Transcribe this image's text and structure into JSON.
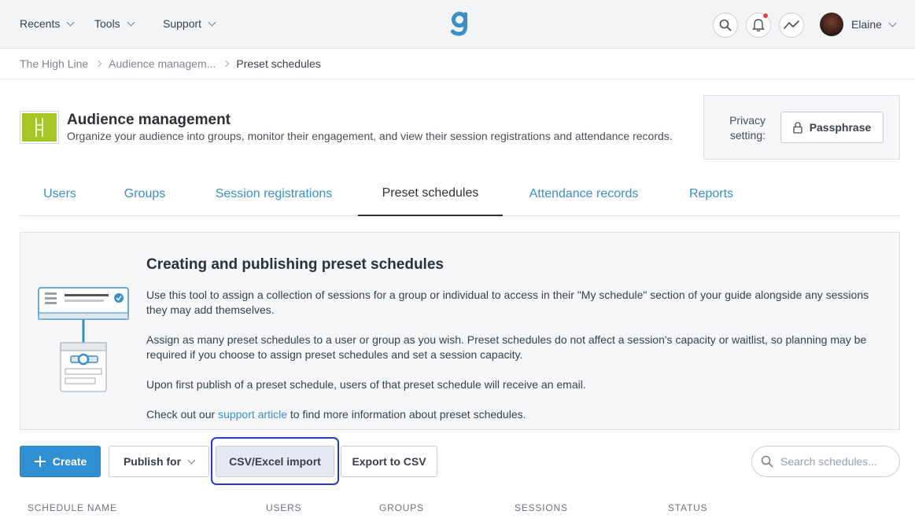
{
  "nav": {
    "menus": [
      {
        "label": "Recents"
      },
      {
        "label": "Tools"
      },
      {
        "label": "Support"
      }
    ],
    "user_name": "Elaine",
    "colors": {
      "logo": "#3a8fc4",
      "notification_dot": "#e3424b"
    }
  },
  "breadcrumb": [
    "The High Line",
    "Audience managem...",
    "Preset schedules"
  ],
  "header": {
    "title": "Audience management",
    "description": "Organize your audience into groups, monitor their engagement,  and view their session registrations and attendance records.",
    "privacy_label_line1": "Privacy",
    "privacy_label_line2": "setting:",
    "passphrase_label": "Passphrase",
    "icon_color": "#a8c526"
  },
  "tabs": [
    {
      "label": "Users"
    },
    {
      "label": "Groups"
    },
    {
      "label": "Session registrations"
    },
    {
      "label": "Preset schedules",
      "active": true
    },
    {
      "label": "Attendance records"
    },
    {
      "label": "Reports"
    }
  ],
  "info": {
    "title": "Creating and publishing preset schedules",
    "p1": "Use this tool to assign a collection of sessions for a group or individual to access in their \"My schedule\" section of your guide alongside any sessions they may add themselves.",
    "p2": "Assign as many preset schedules to a user or group as you wish. Preset schedules do not affect a session's capacity or waitlist, so planning may be required if you choose to assign preset schedules and set a session capacity.",
    "p3": "Upon first publish of a preset schedule, users of that preset schedule will receive an email.",
    "p4_before": "Check out our ",
    "p4_link": "support article",
    "p4_after": " to find more information about preset schedules."
  },
  "toolbar": {
    "create_label": "Create",
    "publish_label": "Publish for",
    "import_label": "CSV/Excel import",
    "export_label": "Export to CSV",
    "search_placeholder": "Search schedules...",
    "accent": "#2f8fd1",
    "highlight": "#2540c4"
  },
  "table": {
    "columns": [
      "SCHEDULE NAME",
      "USERS",
      "GROUPS",
      "SESSIONS",
      "STATUS"
    ]
  }
}
